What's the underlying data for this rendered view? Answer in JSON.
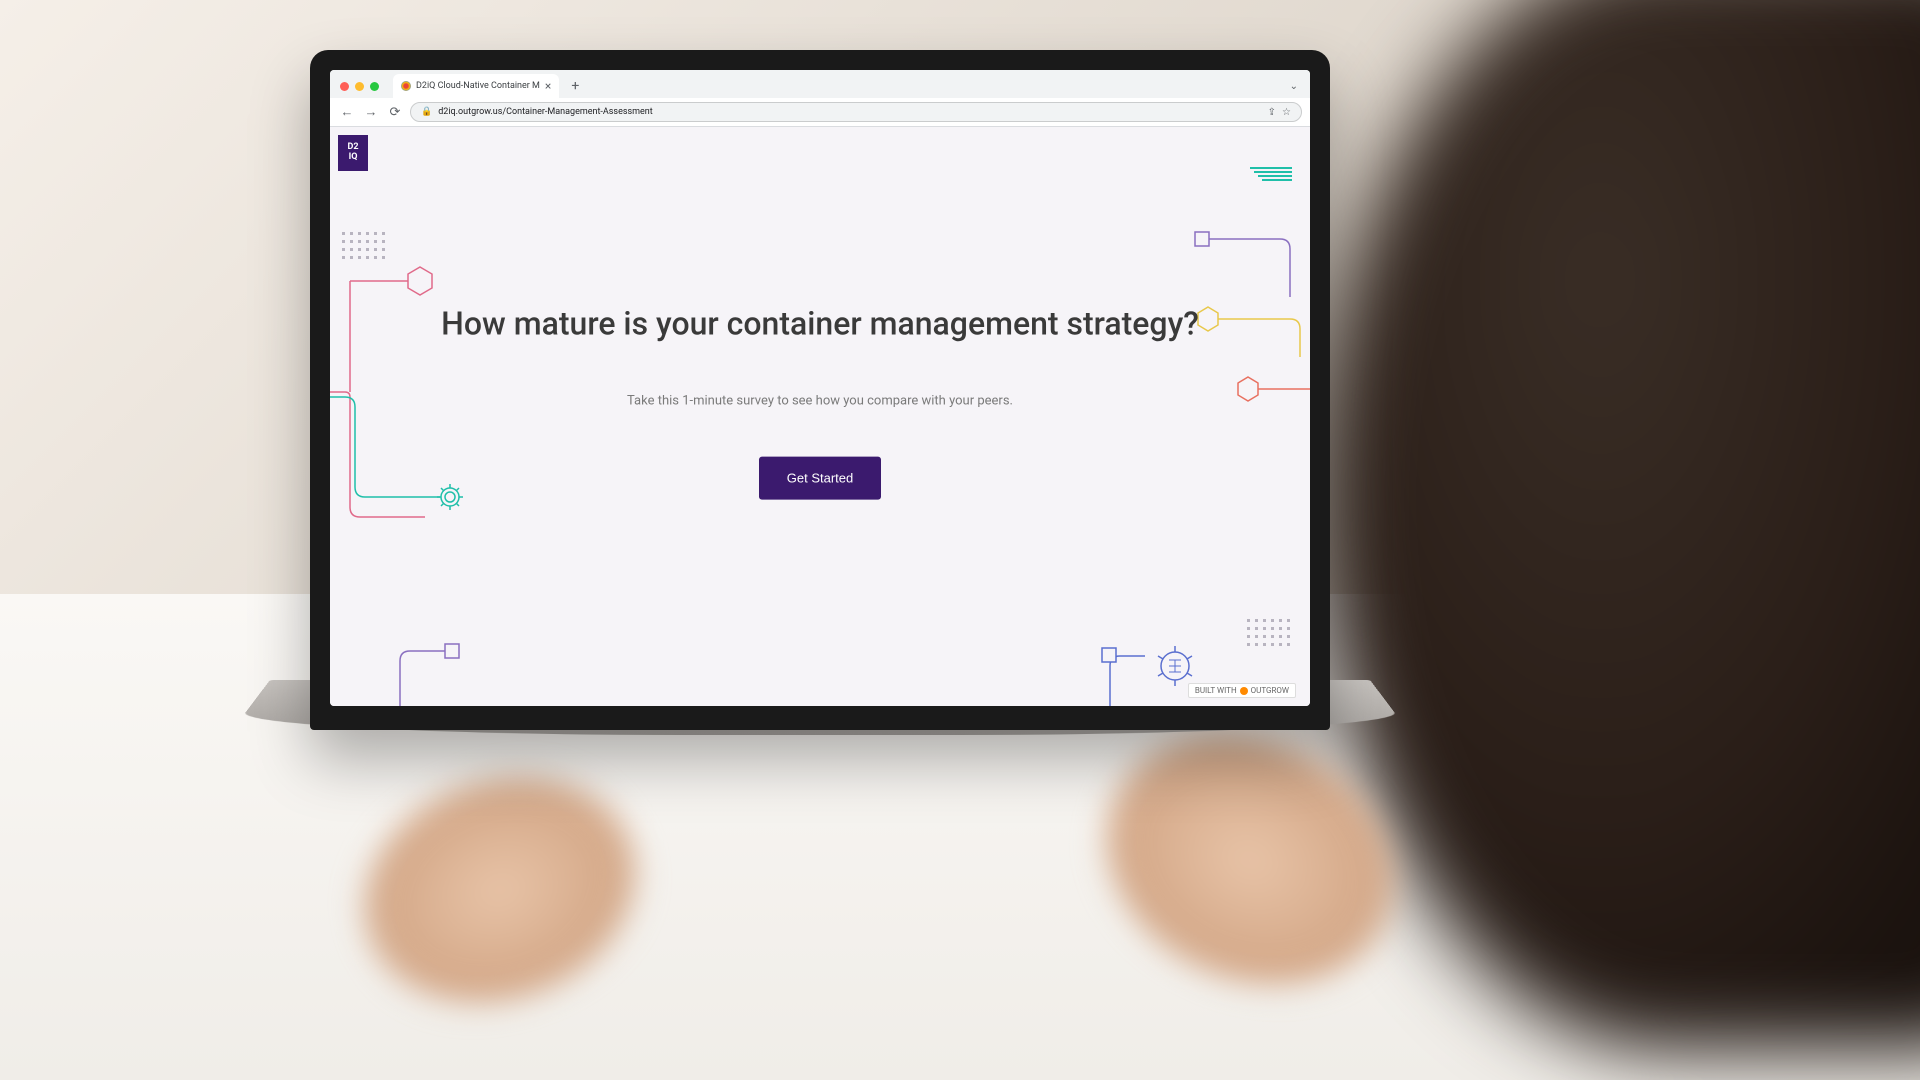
{
  "browser": {
    "tab": {
      "title": "D2iQ Cloud-Native Container M",
      "close": "×"
    },
    "nav": {
      "back": "←",
      "forward": "→",
      "reload": "⟳"
    },
    "address": {
      "url": "d2iq.outgrow.us/Container-Management-Assessment",
      "share": "⇪",
      "star": "☆"
    },
    "new_tab": "+",
    "chevron": "⌄"
  },
  "page": {
    "logo": "D2\nIQ",
    "heading": "How mature is your container management strategy?",
    "subtext": "Take this 1-minute survey to see how you compare with your peers.",
    "cta": "Get Started",
    "badge_prefix": "BUILT WITH",
    "badge_brand": "OUTGROW"
  },
  "colors": {
    "brand_purple": "#3b1a6e",
    "accent_teal": "#1fbfa9",
    "accent_pink": "#e06a8a",
    "accent_yellow": "#e8c84a",
    "accent_red": "#e87060",
    "accent_blue": "#5a6fcf"
  }
}
